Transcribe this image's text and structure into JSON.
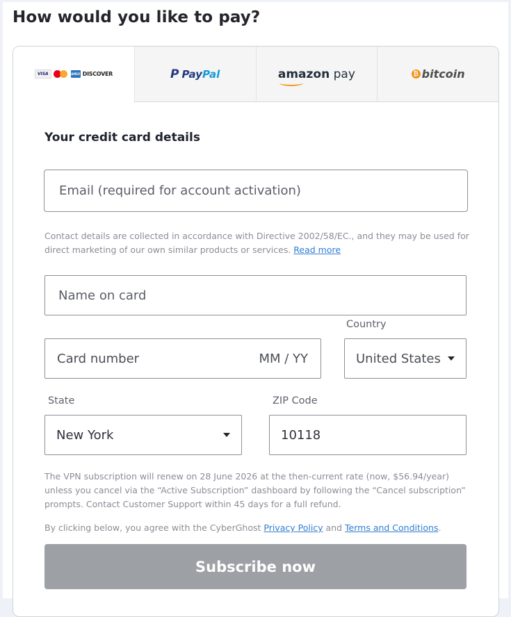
{
  "page": {
    "title": "How would you like to pay?"
  },
  "tabs": [
    {
      "id": "cards",
      "logos": {
        "visa": "VISA",
        "amex": "AMEX",
        "discover": "DISCOVER"
      },
      "active": true
    },
    {
      "id": "paypal",
      "label_a": "Pay",
      "label_b": "Pal",
      "active": false
    },
    {
      "id": "amazon",
      "label_a": "amazon",
      "label_b": " pay",
      "active": false
    },
    {
      "id": "bitcoin",
      "mark": "₿",
      "label": "bitcoin",
      "active": false
    }
  ],
  "form": {
    "section_title": "Your credit card details",
    "email_placeholder": "Email (required for account activation)",
    "contact_note": "Contact details are collected in accordance with Directive 2002/58/EC., and they may be used for direct marketing of our own similar products or services.",
    "read_more": "Read more",
    "name_placeholder": "Name on card",
    "card_number_placeholder": "Card number",
    "expiry_placeholder": "MM / YY",
    "country_label": "Country",
    "country_value": "United States",
    "state_label": "State",
    "state_value": "New York",
    "zip_label": "ZIP Code",
    "zip_value": "10118",
    "renewal_note": "The VPN subscription will renew on 28 June 2026 at the then-current rate (now, $56.94/year) unless you cancel via the “Active Subscription” dashboard by following the “Cancel subscription” prompts. Contact Customer Support within 45 days for a full refund.",
    "agree_prefix": "By clicking below, you agree with the CyberGhost ",
    "privacy_policy": "Privacy Policy",
    "agree_and": " and ",
    "terms": "Terms and Conditions",
    "agree_suffix": ".",
    "subscribe_label": "Subscribe now"
  },
  "colors": {
    "accent_link": "#2f7dd1",
    "button_disabled": "#9da0a4",
    "background": "#eef1f7"
  }
}
